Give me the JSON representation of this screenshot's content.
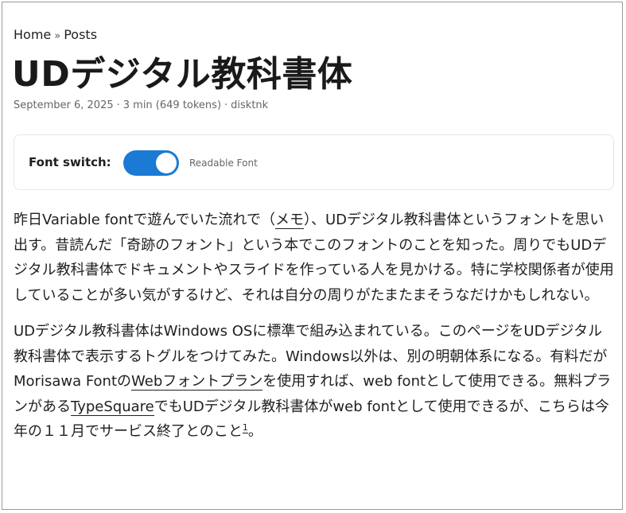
{
  "breadcrumbs": {
    "home": "Home",
    "separator": "»",
    "posts": "Posts"
  },
  "post": {
    "title": "UDデジタル教科書体",
    "date": "September 6, 2025",
    "read_time": "3 min (649 tokens)",
    "author": "disktnk",
    "meta_separator": "·"
  },
  "font_switch": {
    "label": "Font switch:",
    "state_label": "Readable Font",
    "on": true,
    "accent_color": "#1a7ad4"
  },
  "paragraph1": {
    "t1": "昨日Variable fontで遊んでいた流れで（",
    "link_memo": "メモ",
    "t2": "）、UDデジタル教科書体というフォントを思い出す。昔読んだ「奇跡のフォント」という本でこのフォントのことを知った。周りでもUDデジタル教科書体でドキュメントやスライドを作っている人を見かける。特に学校関係者が使用していることが多い気がするけど、それは自分の周りがたまたまそうなだけかもしれない。"
  },
  "paragraph2": {
    "t1": "UDデジタル教科書体はWindows OSに標準で組み込まれている。このページをUDデジタル教科書体で表示するトグルをつけてみた。Windows以外は、別の明朝体系になる。有料だがMorisawa Fontの",
    "link_web_font_plan": "Webフォントプラン",
    "t2": "を使用すれば、web fontとして使用できる。無料プランがある",
    "link_typesquare": "TypeSquare",
    "t3": "でもUDデジタル教科書体がweb fontとして使用できるが、こちらは今年の１１月でサービス終了とのこと",
    "footnote": "1",
    "t4": "。"
  }
}
